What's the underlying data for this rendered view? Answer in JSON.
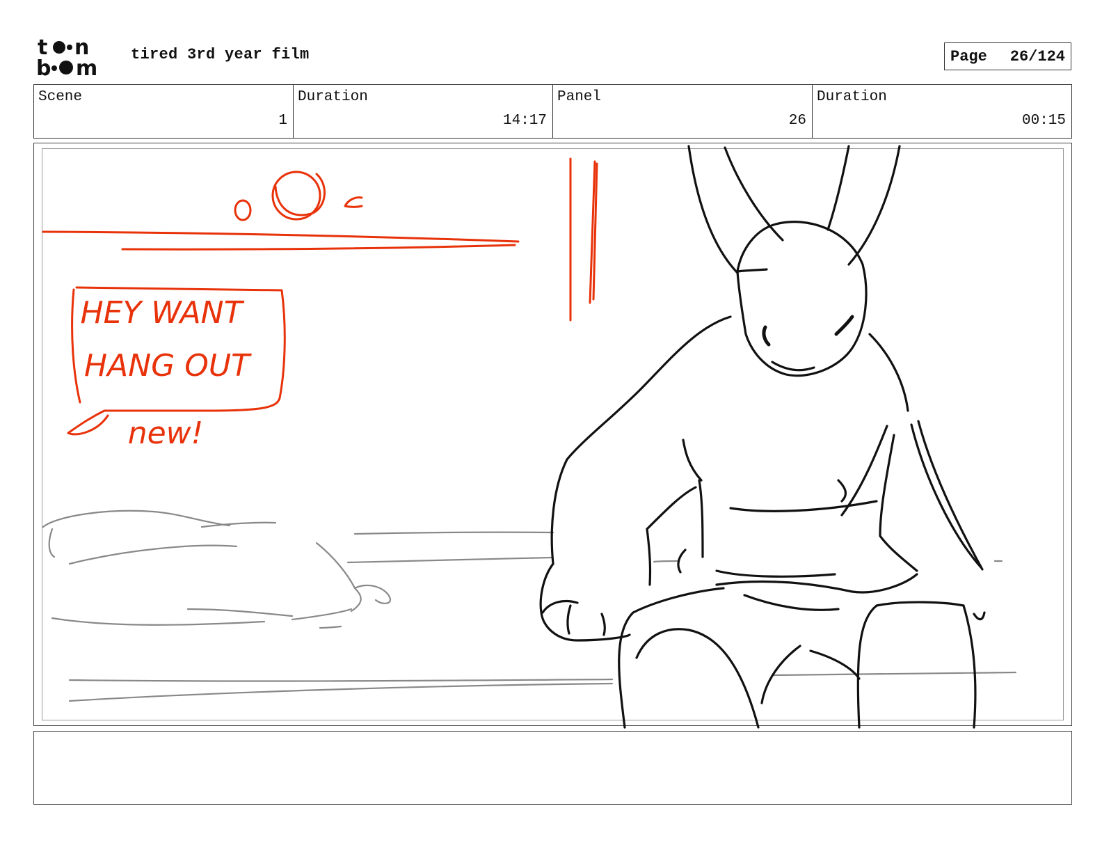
{
  "header": {
    "logo_text": "toon boom",
    "project_title": "tired 3rd year film",
    "page_label": "Page",
    "page_number": "26/124"
  },
  "info": {
    "scene_label": "Scene",
    "scene_value": "1",
    "scene_duration_label": "Duration",
    "scene_duration_value": "14:17",
    "panel_label": "Panel",
    "panel_value": "26",
    "panel_duration_label": "Duration",
    "panel_duration_value": "00:15"
  },
  "panel": {
    "speech_bubble_text": "HEY WANT HANG OUT",
    "handwritten_note": "new!"
  },
  "caption": {
    "text": ""
  },
  "colors": {
    "sketch_red": "#e8320a",
    "sketch_black": "#111111",
    "sketch_grey": "#808080"
  }
}
